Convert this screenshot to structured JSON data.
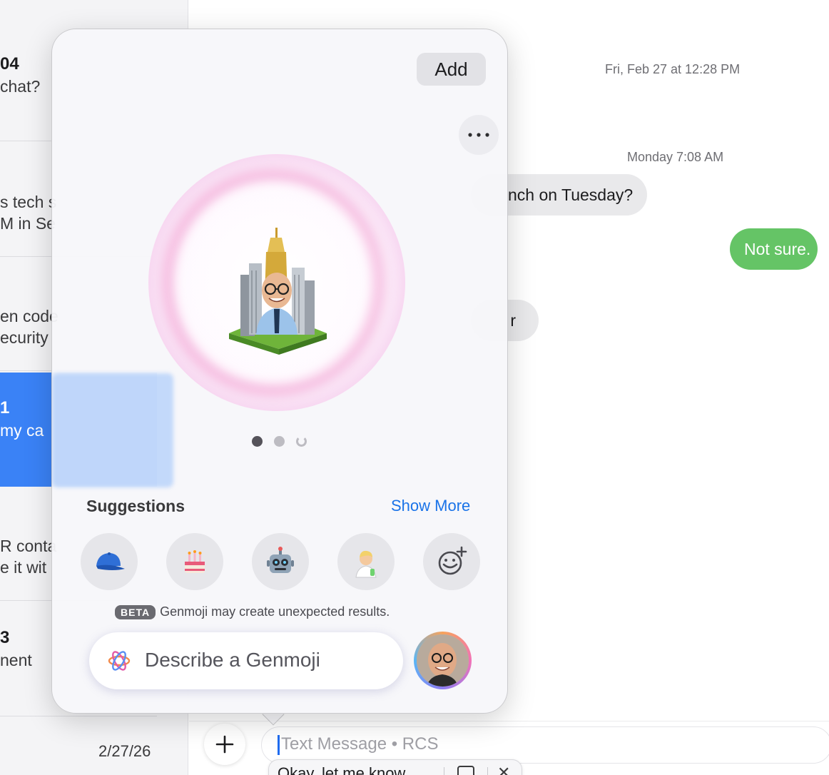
{
  "sidebar": {
    "conversations": [
      {
        "line1": "04",
        "line2": " chat?"
      },
      {
        "line1": "",
        "line2": "s tech s",
        "line3": "M in Se"
      },
      {
        "line1": "",
        "line2": "en code",
        "line3": "ecurity"
      },
      {
        "line1": "1",
        "line2": " my ca",
        "selected": true
      },
      {
        "line1": "",
        "line2": "R conta",
        "line3": "e it wit"
      },
      {
        "line1": "3",
        "line2": "nent"
      }
    ],
    "footer_date": "2/27/26"
  },
  "transcript": {
    "timestamp_1": "Fri, Feb 27 at 12:28 PM",
    "timestamp_2": "Monday 7:08 AM",
    "incoming_1": "nch on Tuesday?",
    "outgoing_1": "Not sure.",
    "incoming_2": "r"
  },
  "compose": {
    "placeholder": "Text Message • RCS",
    "predictive_text": "Okay, let me know",
    "predictive_close": "✕"
  },
  "genmoji": {
    "add_label": "Add",
    "more_icon": "ellipsis-icon",
    "page_count": 3,
    "current_page": 1,
    "suggestions_title": "Suggestions",
    "show_more": "Show More",
    "suggestions": [
      "baseball-cap",
      "birthday-cake",
      "robot-face",
      "scientist",
      "add-emoji"
    ],
    "beta_badge": "BETA",
    "disclaimer": "Genmoji may create unexpected results.",
    "prompt_placeholder": "Describe a Genmoji"
  },
  "colors": {
    "accent_blue": "#1a73e8",
    "selected_row": "#3a82f6",
    "outgoing_bubble": "#65c466",
    "incoming_bubble": "#e9e9eb"
  }
}
